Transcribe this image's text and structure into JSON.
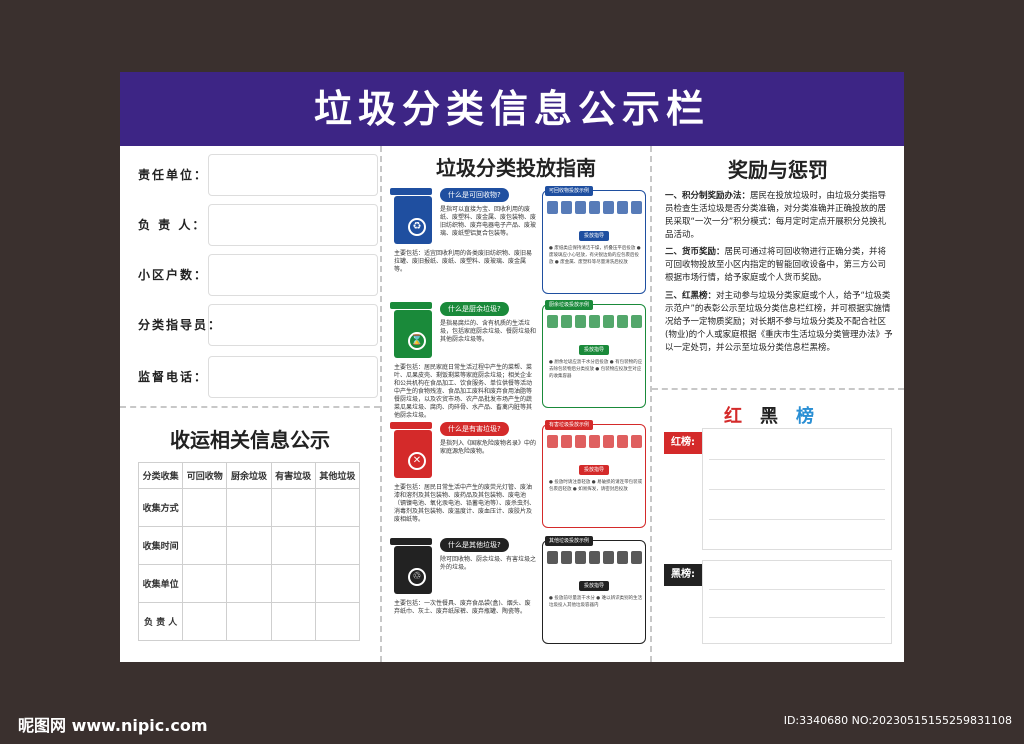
{
  "header": {
    "title": "垃圾分类信息公示栏"
  },
  "info_form": {
    "rows": [
      {
        "label": "责任单位："
      },
      {
        "label": "负  责  人："
      },
      {
        "label": "小区户数："
      },
      {
        "label": "分类指导员："
      },
      {
        "label": "监督电话："
      }
    ]
  },
  "collection": {
    "title": "收运相关信息公示",
    "header_row": [
      "分类收集",
      "可回收物",
      "厨余垃圾",
      "有害垃圾",
      "其他垃圾"
    ],
    "row_labels": [
      "收集方式",
      "收集时间",
      "收集单位",
      "负  责  人"
    ]
  },
  "guide": {
    "title": "垃圾分类投放指南",
    "cards": [
      {
        "color": "#1f4fa0",
        "pill": "什么是可回收物?",
        "bin_symbol": "♻",
        "description": "是指可以直接为宝、回收利用的废纸、废塑料、废金属、废包装物、废旧纺织物、废弃电器电子产品、废玻璃、废纸塑铝复合包装等。",
        "includes": "主要包括：适宜回收利用的各类废旧纺织物、废旧易拉罐、废旧报纸、废纸、废塑料、废玻璃、废金属等。",
        "panel_tag": "可回收物投放示例",
        "panel_tag2": "投放指导",
        "tips": "● 废纸类应保持清洁干燥，折叠压平后投放 ● 废玻璃应小心轻放，有尖锐边角的应包裹后投放 ● 废金属、废塑料等尽量清洗后投放"
      },
      {
        "color": "#1a8a3a",
        "pill": "什么是厨余垃圾?",
        "bin_symbol": "⌛",
        "description": "是指易腐烂的、含有机质的生活垃圾，包括家庭厨余垃圾、餐厨垃圾和其他厨余垃圾等。",
        "includes": "主要包括：居民家庭日常生活过程中产生的菜帮、菜叶、瓜果皮壳、剩饭剩菜等家庭厨余垃圾；相关企业和公共机构在食品加工、饮食服务、单位供餐等活动中产生的食物残渣、食品加工废料和废弃食用油脂等餐厨垃圾，以及农贸市场、农产品批发市场产生的蔬菜瓜果垃圾、腐肉、肉碎骨、水产品、畜禽内脏等其他厨余垃圾。",
        "panel_tag": "厨余垃圾投放示例",
        "panel_tag2": "投放指导",
        "tips": "● 厨余垃圾应沥干水分后投放 ● 有包装物的应去除包装物后分类投放 ● 包装物应投放至对应的收集容器"
      },
      {
        "color": "#d42a2a",
        "pill": "什么是有害垃圾?",
        "bin_symbol": "✕",
        "description": "是指列入《国家危险废物名录》中的家庭源危险废物。",
        "includes": "主要包括：居民日常生活中产生的废荧光灯管、废油漆和溶剂及其包装物、废药品及其包装物、废电池（镉镍电池、氧化汞电池、铅蓄电池等）、废杀虫剂、消毒剂及其包装物、废温度计、废血压计、废胶片及废相纸等。",
        "panel_tag": "有害垃圾投放示例",
        "panel_tag2": "投放指导",
        "tips": "● 投放时请注意轻放 ● 易破损的请连带包装或包裹后轻放 ● 如易挥发，请密封后投放"
      },
      {
        "color": "#222222",
        "pill": "什么是其他垃圾?",
        "bin_symbol": "♲",
        "description": "除可回收物、厨余垃圾、有害垃圾之外的垃圾。",
        "includes": "主要包括：一次性餐具、废弃食品袋(盒)、烟头、废弃纸巾、灰土、废弃纸尿裤、废弃瓶罐、陶瓷等。",
        "panel_tag": "其他垃圾投放示例",
        "panel_tag2": "投放指导",
        "tips": "● 投放前尽量沥干水分 ● 难以辨识类别的生活垃圾投入其他垃圾容器内"
      }
    ]
  },
  "rewards": {
    "title": "奖励与惩罚",
    "items": [
      {
        "head": "一、积分制奖励办法：",
        "text": "居民在投放垃圾时，由垃圾分类指导员检查生活垃圾是否分类准确，对分类准确并正确投放的居民采取“一次一分”积分模式：每月定时定点开展积分兑换礼品活动。"
      },
      {
        "head": "二、货币奖励：",
        "text": "居民可通过将可回收物进行正确分类，并将可回收物投放至小区内指定的智能回收设备中，第三方公司根据市场行情，给予家庭或个人货币奖励。"
      },
      {
        "head": "三、红黑榜：",
        "text": "对主动参与垃圾分类家庭或个人，给予“垃圾类示范户”的表彰公示至垃圾分类信息栏红榜，并可根据实施情况给予一定物质奖励；对长期不参与垃圾分类及不配合社区(物业)的个人或家庭根据《重庆市生活垃圾分类管理办法》予以一定处罚，并公示至垃圾分类信息栏黑榜。"
      }
    ]
  },
  "ranking": {
    "title_chars": [
      "红",
      "黑",
      "榜"
    ],
    "title_colors": [
      "#d42a2a",
      "#222222",
      "#2a8fd4"
    ],
    "red_label": "红榜:",
    "black_label": "黑榜:"
  },
  "footer": {
    "left": "昵图网 www.nipic.com",
    "right": "ID:3340680 NO:20230515155259831108"
  }
}
